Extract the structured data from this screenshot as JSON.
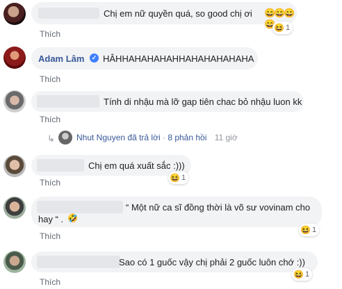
{
  "comments": [
    {
      "text": "Chị em nữ quyền quá, so good chị ơi",
      "reply": "Thích",
      "reaction_count": "1"
    },
    {
      "author": "Adam Lâm",
      "text": "HÂHHAHAHAHAHHAHAHAHAHAHA",
      "reply": "Thích"
    },
    {
      "text": "Tính di nhậu mà lỡ gap tiên chac bỏ nhậu luon kk",
      "reply": "Thích"
    },
    {
      "text": "Chị em quá xuất sắc :)))",
      "reply": "Thích",
      "reaction_count": "1"
    },
    {
      "text_line1": "“ Một nữ ca sĩ đồng thời là võ sư vovinam cho",
      "text_line2": "hay “ .",
      "reply": "Thích",
      "reaction_count": "1"
    },
    {
      "text": "Sao có 1 guốc vậy chị phải 2 guốc luôn chớ :))",
      "reply": "Thích",
      "reaction_count": "1"
    }
  ],
  "replies_summary": {
    "name": "Nhut Nguyen",
    "action": "đã trả lời",
    "separator": "·",
    "count": "8 phản hồi",
    "time": "11 giờ"
  },
  "colors": {
    "bubble": "#f2f3f5",
    "link": "#606770",
    "name": "#385898",
    "text": "#1c1e21"
  }
}
